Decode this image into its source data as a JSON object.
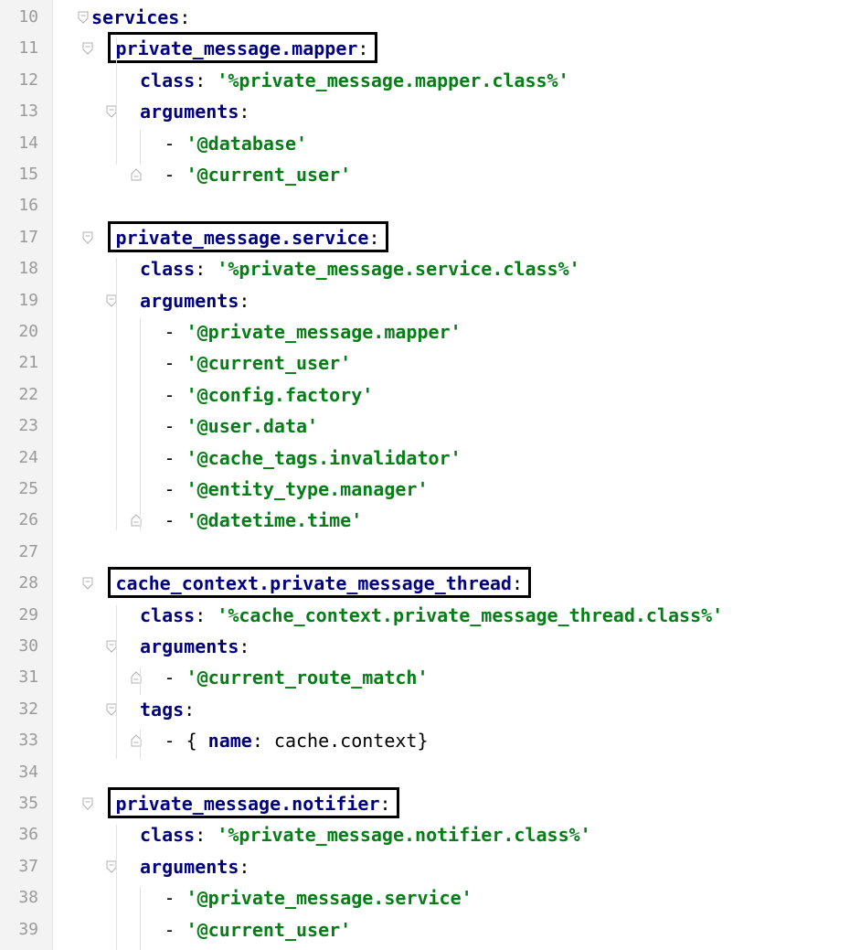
{
  "editor": {
    "lines": [
      {
        "n": "10",
        "indent": 0,
        "fold": "open",
        "parts": [
          {
            "t": "key",
            "v": "services"
          },
          {
            "t": "pl",
            "v": ":"
          }
        ]
      },
      {
        "n": "11",
        "indent": 1,
        "fold": "open",
        "box": true,
        "parts": [
          {
            "t": "key",
            "v": "private_message.mapper"
          },
          {
            "t": "pl",
            "v": ":"
          }
        ]
      },
      {
        "n": "12",
        "indent": 2,
        "parts": [
          {
            "t": "key",
            "v": "class"
          },
          {
            "t": "pl",
            "v": ": "
          },
          {
            "t": "str",
            "v": "'%private_message.mapper.class%'"
          }
        ]
      },
      {
        "n": "13",
        "indent": 2,
        "fold": "open",
        "parts": [
          {
            "t": "key",
            "v": "arguments"
          },
          {
            "t": "pl",
            "v": ":"
          }
        ]
      },
      {
        "n": "14",
        "indent": 3,
        "parts": [
          {
            "t": "pl",
            "v": "- "
          },
          {
            "t": "str",
            "v": "'@database'"
          }
        ]
      },
      {
        "n": "15",
        "indent": 3,
        "fold": "end",
        "parts": [
          {
            "t": "pl",
            "v": "- "
          },
          {
            "t": "str",
            "v": "'@current_user'"
          }
        ]
      },
      {
        "n": "16",
        "indent": 0,
        "parts": []
      },
      {
        "n": "17",
        "indent": 1,
        "fold": "open",
        "box": true,
        "parts": [
          {
            "t": "key",
            "v": "private_message.service"
          },
          {
            "t": "pl",
            "v": ":"
          }
        ]
      },
      {
        "n": "18",
        "indent": 2,
        "parts": [
          {
            "t": "key",
            "v": "class"
          },
          {
            "t": "pl",
            "v": ": "
          },
          {
            "t": "str",
            "v": "'%private_message.service.class%'"
          }
        ]
      },
      {
        "n": "19",
        "indent": 2,
        "fold": "open",
        "parts": [
          {
            "t": "key",
            "v": "arguments"
          },
          {
            "t": "pl",
            "v": ":"
          }
        ]
      },
      {
        "n": "20",
        "indent": 3,
        "parts": [
          {
            "t": "pl",
            "v": "- "
          },
          {
            "t": "str",
            "v": "'@private_message.mapper'"
          }
        ]
      },
      {
        "n": "21",
        "indent": 3,
        "parts": [
          {
            "t": "pl",
            "v": "- "
          },
          {
            "t": "str",
            "v": "'@current_user'"
          }
        ]
      },
      {
        "n": "22",
        "indent": 3,
        "parts": [
          {
            "t": "pl",
            "v": "- "
          },
          {
            "t": "str",
            "v": "'@config.factory'"
          }
        ]
      },
      {
        "n": "23",
        "indent": 3,
        "parts": [
          {
            "t": "pl",
            "v": "- "
          },
          {
            "t": "str",
            "v": "'@user.data'"
          }
        ]
      },
      {
        "n": "24",
        "indent": 3,
        "parts": [
          {
            "t": "pl",
            "v": "- "
          },
          {
            "t": "str",
            "v": "'@cache_tags.invalidator'"
          }
        ]
      },
      {
        "n": "25",
        "indent": 3,
        "parts": [
          {
            "t": "pl",
            "v": "- "
          },
          {
            "t": "str",
            "v": "'@entity_type.manager'"
          }
        ]
      },
      {
        "n": "26",
        "indent": 3,
        "fold": "end",
        "parts": [
          {
            "t": "pl",
            "v": "- "
          },
          {
            "t": "str",
            "v": "'@datetime.time'"
          }
        ]
      },
      {
        "n": "27",
        "indent": 0,
        "parts": []
      },
      {
        "n": "28",
        "indent": 1,
        "fold": "open",
        "box": true,
        "parts": [
          {
            "t": "key",
            "v": "cache_context.private_message_thread"
          },
          {
            "t": "pl",
            "v": ":"
          }
        ]
      },
      {
        "n": "29",
        "indent": 2,
        "parts": [
          {
            "t": "key",
            "v": "class"
          },
          {
            "t": "pl",
            "v": ": "
          },
          {
            "t": "str",
            "v": "'%cache_context.private_message_thread.class%'"
          }
        ]
      },
      {
        "n": "30",
        "indent": 2,
        "fold": "open",
        "parts": [
          {
            "t": "key",
            "v": "arguments"
          },
          {
            "t": "pl",
            "v": ":"
          }
        ]
      },
      {
        "n": "31",
        "indent": 3,
        "fold": "end",
        "parts": [
          {
            "t": "pl",
            "v": "- "
          },
          {
            "t": "str",
            "v": "'@current_route_match'"
          }
        ]
      },
      {
        "n": "32",
        "indent": 2,
        "fold": "open",
        "parts": [
          {
            "t": "key",
            "v": "tags"
          },
          {
            "t": "pl",
            "v": ":"
          }
        ]
      },
      {
        "n": "33",
        "indent": 3,
        "fold": "end",
        "parts": [
          {
            "t": "pl",
            "v": "- { "
          },
          {
            "t": "key",
            "v": "name"
          },
          {
            "t": "pl",
            "v": ": cache.context}"
          }
        ]
      },
      {
        "n": "34",
        "indent": 0,
        "parts": []
      },
      {
        "n": "35",
        "indent": 1,
        "fold": "open",
        "box": true,
        "parts": [
          {
            "t": "key",
            "v": "private_message.notifier"
          },
          {
            "t": "pl",
            "v": ":"
          }
        ]
      },
      {
        "n": "36",
        "indent": 2,
        "parts": [
          {
            "t": "key",
            "v": "class"
          },
          {
            "t": "pl",
            "v": ": "
          },
          {
            "t": "str",
            "v": "'%private_message.notifier.class%'"
          }
        ]
      },
      {
        "n": "37",
        "indent": 2,
        "fold": "open",
        "parts": [
          {
            "t": "key",
            "v": "arguments"
          },
          {
            "t": "pl",
            "v": ":"
          }
        ]
      },
      {
        "n": "38",
        "indent": 3,
        "parts": [
          {
            "t": "pl",
            "v": "- "
          },
          {
            "t": "str",
            "v": "'@private_message.service'"
          }
        ]
      },
      {
        "n": "39",
        "indent": 3,
        "parts": [
          {
            "t": "pl",
            "v": "- "
          },
          {
            "t": "str",
            "v": "'@current_user'"
          }
        ]
      }
    ]
  }
}
